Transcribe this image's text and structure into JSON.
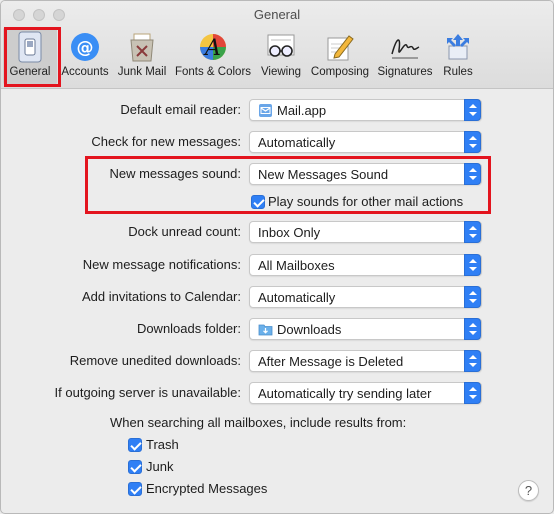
{
  "window": {
    "title": "General"
  },
  "toolbar": {
    "items": [
      {
        "label": "General",
        "icon": "switch-icon"
      },
      {
        "label": "Accounts",
        "icon": "at-sign-icon"
      },
      {
        "label": "Junk Mail",
        "icon": "trash-bin-icon"
      },
      {
        "label": "Fonts & Colors",
        "icon": "font-palette-icon"
      },
      {
        "label": "Viewing",
        "icon": "glasses-icon"
      },
      {
        "label": "Composing",
        "icon": "pencil-paper-icon"
      },
      {
        "label": "Signatures",
        "icon": "signature-icon"
      },
      {
        "label": "Rules",
        "icon": "rules-arrows-icon"
      }
    ]
  },
  "settings": {
    "default_reader": {
      "label": "Default email reader:",
      "value": "Mail.app",
      "icon": "mail-app-icon"
    },
    "check_messages": {
      "label": "Check for new messages:",
      "value": "Automatically"
    },
    "new_sound": {
      "label": "New messages sound:",
      "value": "New Messages Sound"
    },
    "play_sounds": {
      "label": "Play sounds for other mail actions",
      "checked": true
    },
    "dock_unread": {
      "label": "Dock unread count:",
      "value": "Inbox Only"
    },
    "notifications": {
      "label": "New message notifications:",
      "value": "All Mailboxes"
    },
    "invitations": {
      "label": "Add invitations to Calendar:",
      "value": "Automatically"
    },
    "downloads_folder": {
      "label": "Downloads folder:",
      "value": "Downloads",
      "icon": "folder-icon"
    },
    "remove_downloads": {
      "label": "Remove unedited downloads:",
      "value": "After Message is Deleted"
    },
    "outgoing": {
      "label": "If outgoing server is unavailable:",
      "value": "Automatically try sending later"
    }
  },
  "search": {
    "heading": "When searching all mailboxes, include results from:",
    "options": [
      {
        "label": "Trash",
        "checked": true
      },
      {
        "label": "Junk",
        "checked": true
      },
      {
        "label": "Encrypted Messages",
        "checked": true
      }
    ]
  },
  "help": {
    "label": "?"
  },
  "colors": {
    "accent": "#2f7ff5",
    "highlight_box": "#e3141e",
    "window_bg": "#ececec"
  }
}
